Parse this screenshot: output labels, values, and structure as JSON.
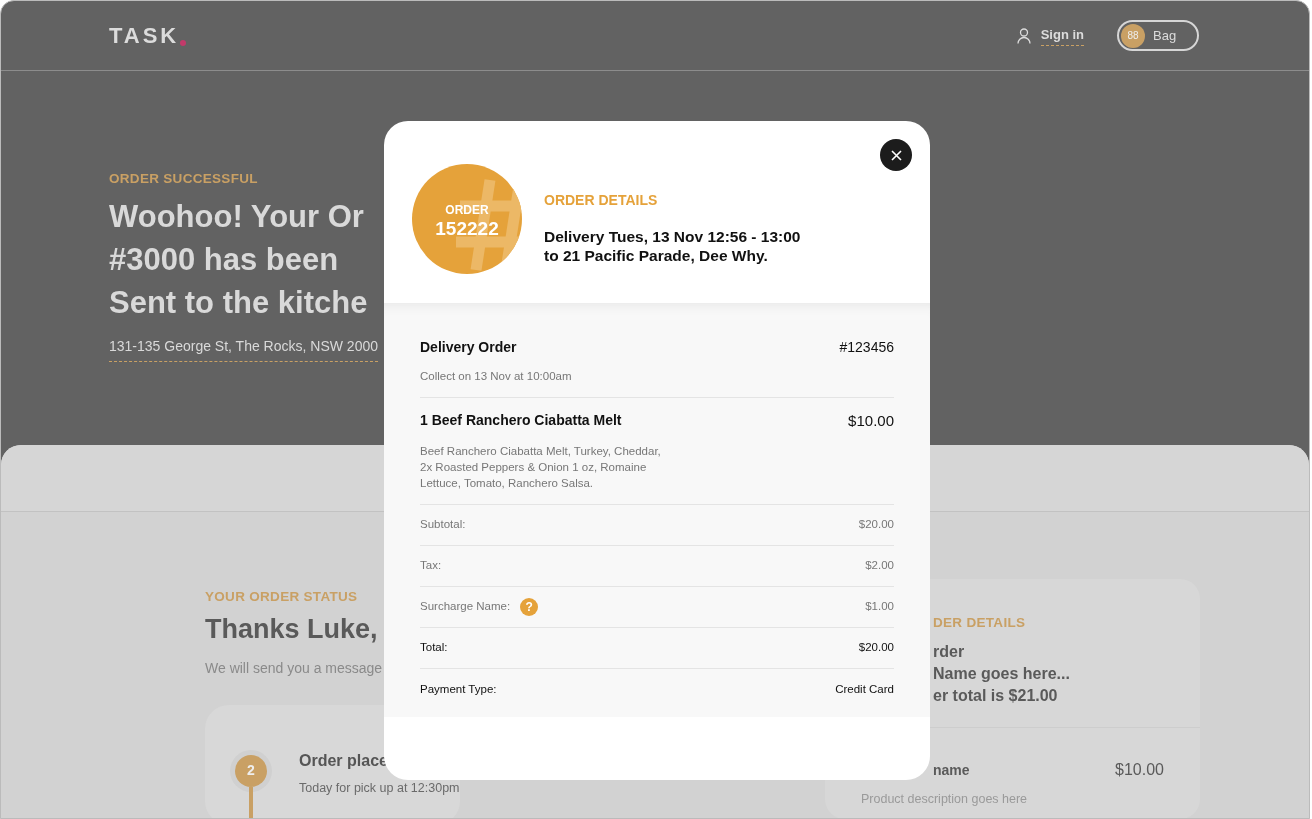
{
  "header": {
    "logo": "TASK",
    "sign_in": "Sign in",
    "bag": {
      "count": "88",
      "label": "Bag"
    }
  },
  "hero": {
    "eyebrow": "ORDER SUCCESSFUL",
    "title_lines": [
      "Woohoo! Your Or",
      "#3000 has been",
      "Sent to the kitche"
    ],
    "address": "131-135 George St, The Rocks, NSW 2000"
  },
  "status": {
    "eyebrow": "YOUR ORDER STATUS",
    "title": "Thanks Luke,",
    "message": "We will send you a message",
    "steps": [
      {
        "number": "2",
        "title": "Order place",
        "subtitle": "Today for pick up at 12:30pm"
      }
    ]
  },
  "summary_card": {
    "eyebrow": "DER DETAILS",
    "lines": [
      "rder",
      "Name goes here...",
      "er total is $21.00"
    ],
    "item": {
      "name": "name",
      "price": "$10.00",
      "description": "Product description goes here"
    }
  },
  "modal": {
    "badge": {
      "label": "ORDER",
      "number": "152222"
    },
    "eyebrow": "ORDER DETAILS",
    "heading_lines": [
      "Delivery Tues, 13 Nov 12:56 - 13:00",
      "to 21 Pacific Parade, Dee Why."
    ],
    "order": {
      "title": "Delivery Order",
      "number": "#123456",
      "note": "Collect on 13 Nov at 10:00am"
    },
    "items": [
      {
        "name": "1 Beef Ranchero Ciabatta Melt",
        "price": "$10.00",
        "description": "Beef Ranchero Ciabatta Melt, Turkey, Cheddar, 2x Roasted Peppers & Onion 1 oz, Romaine Lettuce, Tomato, Ranchero Salsa."
      }
    ],
    "totals": [
      {
        "label": "Subtotal:",
        "value": "$20.00",
        "kind": "muted"
      },
      {
        "label": "Tax:",
        "value": "$2.00",
        "kind": "muted"
      },
      {
        "label": "Surcharge Name:",
        "value": "$1.00",
        "kind": "muted",
        "help_icon": "?"
      },
      {
        "label": "Total:",
        "value": "$20.00",
        "kind": "strong"
      },
      {
        "label": "Payment Type:",
        "value": "Credit Card",
        "kind": "strong"
      }
    ]
  }
}
